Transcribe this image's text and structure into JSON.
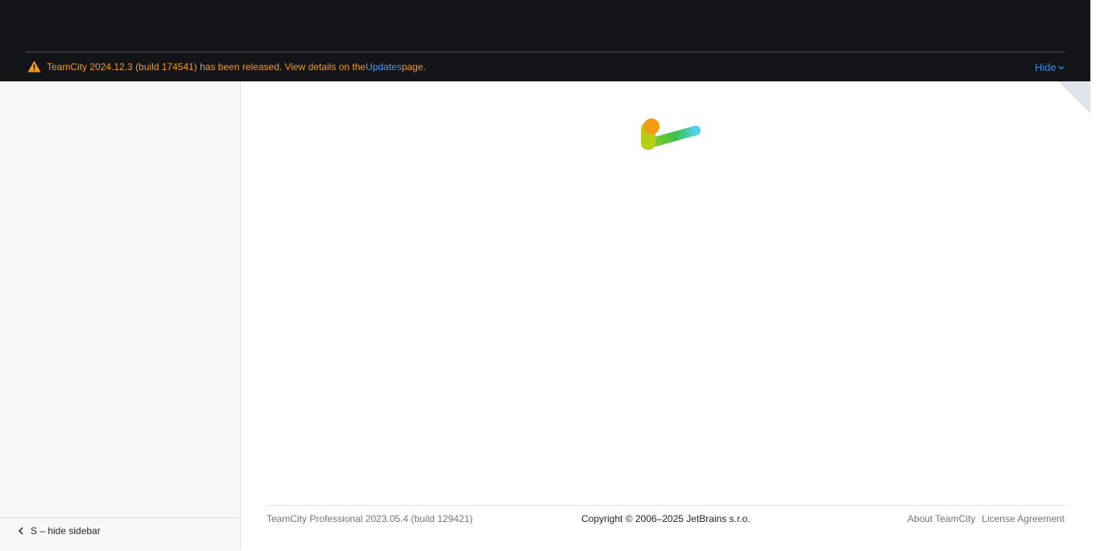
{
  "banner": {
    "message_before": "TeamCity 2024.12.3 (build 174541) has been released. View details on the ",
    "link_text": "Updates",
    "message_after": " page.",
    "hide_label": "Hide",
    "icon": "warning-icon",
    "color": "#f09c1f",
    "link_color": "#4d9de8"
  },
  "sidebar": {
    "hide_label": "S – hide sidebar",
    "icon": "chevron-left-icon"
  },
  "loader": {
    "icon": "teamcity-loader-icon"
  },
  "footer": {
    "version": "TeamCity Professional 2023.05.4 (build 129421)",
    "copyright": "Copyright © 2006–2025 JetBrains s.r.o.",
    "links": [
      "About TeamCity",
      "License Agreement"
    ]
  },
  "colors": {
    "header_bg": "#131417",
    "sidebar_bg": "#f7f8fa",
    "accent": "#2c8ff0"
  }
}
